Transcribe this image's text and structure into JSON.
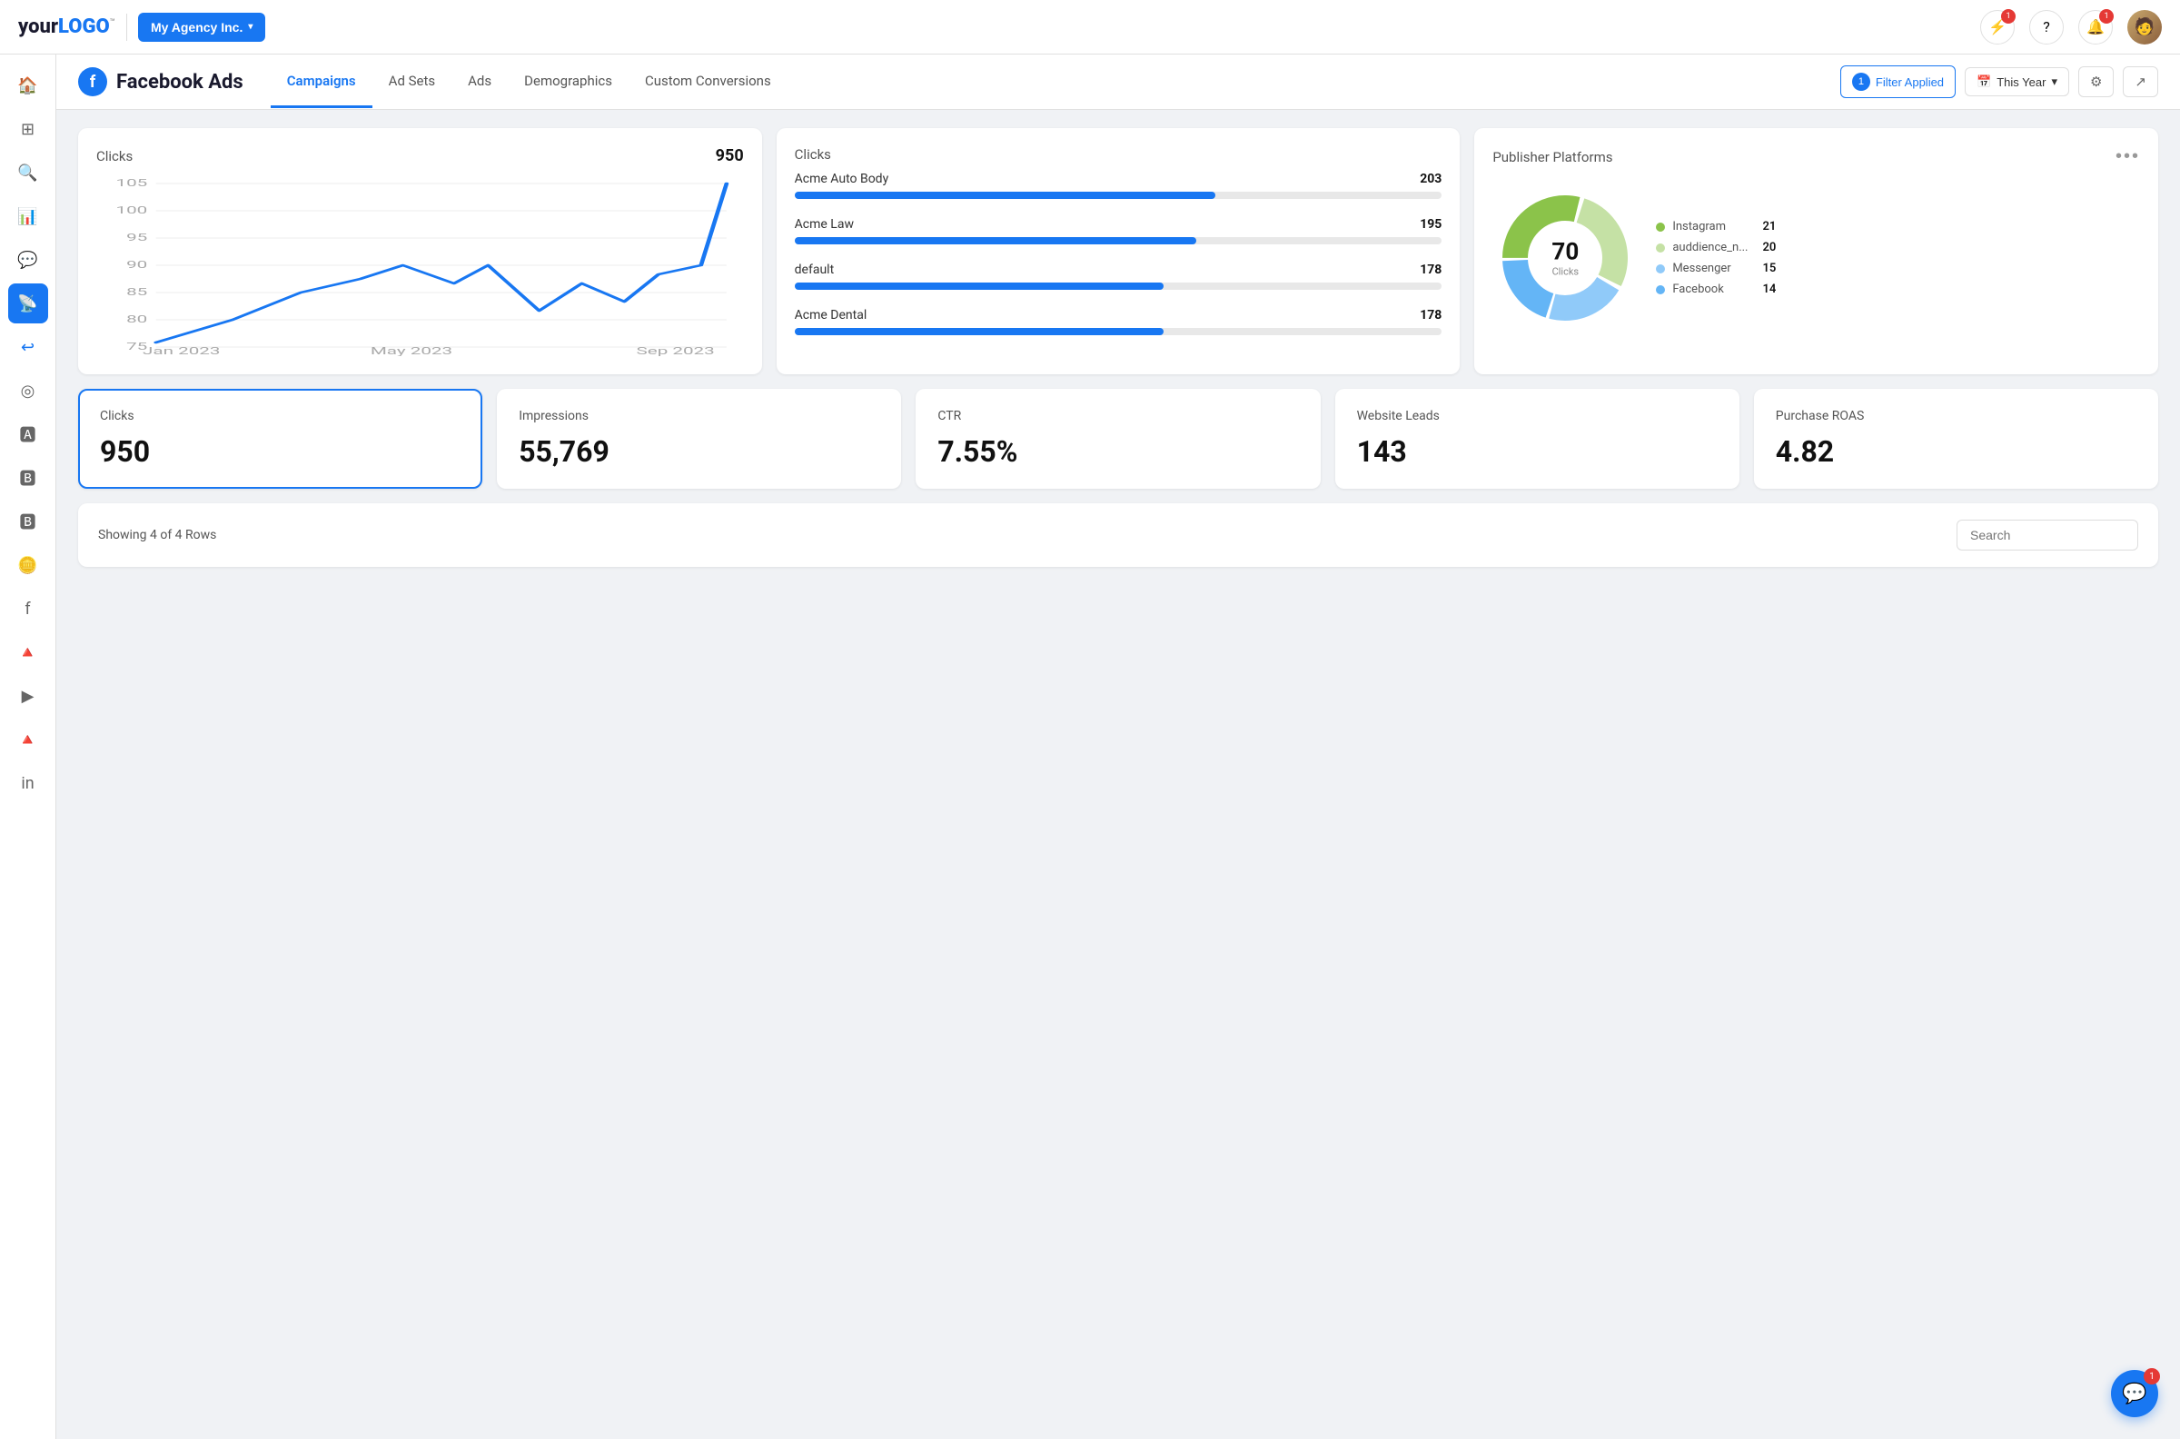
{
  "app": {
    "logo_prefix": "your",
    "logo_suffix": "LOGO",
    "logo_tm": "™"
  },
  "top_nav": {
    "agency_label": "My Agency Inc.",
    "icons": {
      "lightning": "⚡",
      "help": "?",
      "bell": "🔔",
      "lightning_badge": "1",
      "bell_badge": "1",
      "chat_badge": "1"
    }
  },
  "sub_header": {
    "page_title": "Facebook Ads",
    "tabs": [
      {
        "label": "Campaigns",
        "active": true
      },
      {
        "label": "Ad Sets",
        "active": false
      },
      {
        "label": "Ads",
        "active": false
      },
      {
        "label": "Demographics",
        "active": false
      },
      {
        "label": "Custom Conversions",
        "active": false
      }
    ],
    "filter_label": "Filter Applied",
    "filter_count": "1",
    "date_label": "This Year",
    "columns_icon": "⚙",
    "share_icon": "↗"
  },
  "clicks_chart": {
    "title": "Clicks",
    "value": "950",
    "y_labels": [
      "105",
      "100",
      "95",
      "90",
      "85",
      "80",
      "75"
    ],
    "x_labels": [
      "Jan 2023",
      "May 2023",
      "Sep 2023"
    ]
  },
  "bar_list_card": {
    "title": "Clicks",
    "items": [
      {
        "label": "Acme Auto Body",
        "value": "203",
        "pct": 65
      },
      {
        "label": "Acme Law",
        "value": "195",
        "pct": 62
      },
      {
        "label": "default",
        "value": "178",
        "pct": 57
      },
      {
        "label": "Acme Dental",
        "value": "178",
        "pct": 57
      }
    ]
  },
  "publisher_card": {
    "title": "Publisher Platforms",
    "donut_center_value": "70",
    "donut_center_label": "Clicks",
    "legend": [
      {
        "name": "Instagram",
        "value": "21",
        "color": "#8bc34a"
      },
      {
        "name": "auddience_n...",
        "value": "20",
        "color": "#c5e1a5"
      },
      {
        "name": "Messenger",
        "value": "15",
        "color": "#90caf9"
      },
      {
        "name": "Facebook",
        "value": "14",
        "color": "#64b5f6"
      }
    ],
    "donut_segments": [
      {
        "value": 21,
        "color": "#8bc34a"
      },
      {
        "value": 20,
        "color": "#c5e1a5"
      },
      {
        "value": 15,
        "color": "#90caf9"
      },
      {
        "value": 14,
        "color": "#64b5f6"
      }
    ]
  },
  "metric_cards": [
    {
      "label": "Clicks",
      "value": "950",
      "selected": true
    },
    {
      "label": "Impressions",
      "value": "55,769",
      "selected": false
    },
    {
      "label": "CTR",
      "value": "7.55%",
      "selected": false
    },
    {
      "label": "Website Leads",
      "value": "143",
      "selected": false
    },
    {
      "label": "Purchase ROAS",
      "value": "4.82",
      "selected": false
    }
  ],
  "table_bar": {
    "showing_text": "Showing 4 of 4 Rows",
    "search_placeholder": "Search"
  }
}
